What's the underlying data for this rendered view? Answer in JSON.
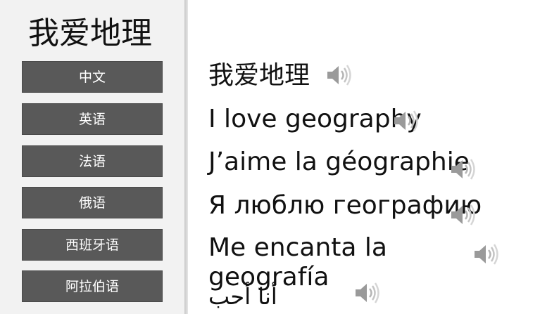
{
  "sidebar": {
    "title": "我爱地理",
    "buttons": [
      {
        "label": "中文"
      },
      {
        "label": "英语"
      },
      {
        "label": "法语"
      },
      {
        "label": "俄语"
      },
      {
        "label": "西班牙语"
      },
      {
        "label": "阿拉伯语"
      }
    ]
  },
  "main": {
    "phrases": [
      {
        "text": "我爱地理",
        "icon": "speaker-icon"
      },
      {
        "text": "I love geography",
        "icon": "speaker-icon"
      },
      {
        "text": "J’aime la géographie",
        "icon": "speaker-icon"
      },
      {
        "text": "Я люблю географию",
        "icon": "speaker-icon"
      },
      {
        "text": "Me encanta la geografía",
        "icon": "speaker-icon"
      },
      {
        "text": "أنا أحب",
        "icon": "speaker-icon"
      }
    ]
  },
  "colors": {
    "sidebar_bg": "#f2f2f2",
    "button_bg": "#595959",
    "button_text": "#ffffff",
    "text": "#111111"
  }
}
